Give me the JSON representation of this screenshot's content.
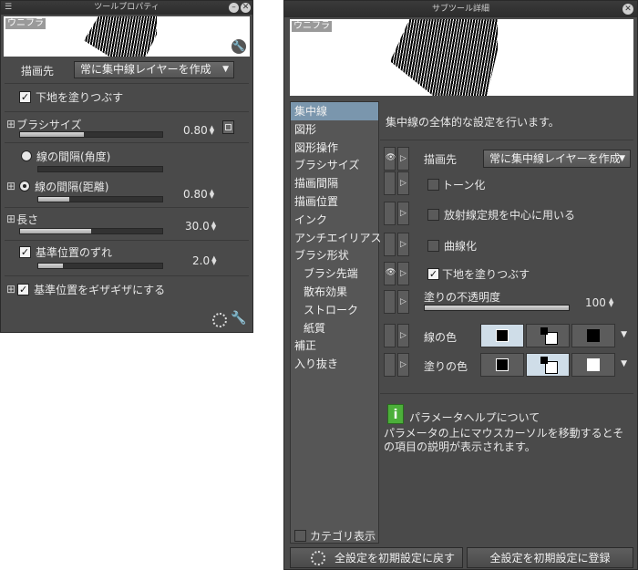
{
  "tool_property": {
    "title": "ツールプロパティ",
    "preview_label": "ウニフラ",
    "draw_target_label": "描画先",
    "draw_target_value": "常に集中線レイヤーを作成",
    "fill_base_label": "下地を塗りつぶす",
    "brush_size_label": "ブラシサイズ",
    "brush_size_value": "0.80",
    "brush_size_fill": 0.45,
    "spacing_angle_label": "線の間隔(角度)",
    "spacing_distance_label": "線の間隔(距離)",
    "spacing_distance_value": "0.80",
    "spacing_distance_fill": 0.25,
    "length_label": "長さ",
    "length_value": "30.0",
    "length_fill": 0.5,
    "ref_offset_label": "基準位置のずれ",
    "ref_offset_value": "2.0",
    "ref_offset_fill": 0.2,
    "ref_jagged_label": "基準位置をギザギザにする"
  },
  "sub_tool_detail": {
    "title": "サブツール詳細",
    "preview_label": "ウニフラ",
    "categories": [
      {
        "label": "集中線",
        "selected": true,
        "sub": false
      },
      {
        "label": "図形",
        "selected": false,
        "sub": false
      },
      {
        "label": "図形操作",
        "selected": false,
        "sub": false
      },
      {
        "label": "ブラシサイズ",
        "selected": false,
        "sub": false
      },
      {
        "label": "描画間隔",
        "selected": false,
        "sub": false
      },
      {
        "label": "描画位置",
        "selected": false,
        "sub": false
      },
      {
        "label": "インク",
        "selected": false,
        "sub": false
      },
      {
        "label": "アンチエイリアス",
        "selected": false,
        "sub": false
      },
      {
        "label": "ブラシ形状",
        "selected": false,
        "sub": false
      },
      {
        "label": "ブラシ先端",
        "selected": false,
        "sub": true
      },
      {
        "label": "散布効果",
        "selected": false,
        "sub": true
      },
      {
        "label": "ストローク",
        "selected": false,
        "sub": true
      },
      {
        "label": "紙質",
        "selected": false,
        "sub": true
      },
      {
        "label": "補正",
        "selected": false,
        "sub": false
      },
      {
        "label": "入り抜き",
        "selected": false,
        "sub": false
      }
    ],
    "category_display_label": "カテゴリ表示",
    "heading": "集中線の全体的な設定を行います。",
    "draw_target_label": "描画先",
    "draw_target_value": "常に集中線レイヤーを作成",
    "tone_label": "トーン化",
    "radial_label": "放射線定規を中心に用いる",
    "curve_label": "曲線化",
    "fill_base_label": "下地を塗りつぶす",
    "fill_opacity_label": "塗りの不透明度",
    "fill_opacity_value": "100",
    "fill_opacity_fill": 1.0,
    "line_color_label": "線の色",
    "fill_color_label": "塗りの色",
    "help_title": "パラメータヘルプについて",
    "help_text": "パラメータの上にマウスカーソルを移動するとその項目の説明が表示されます。",
    "reset_button": "全設定を初期設定に戻す",
    "register_button": "全設定を初期設定に登録"
  }
}
